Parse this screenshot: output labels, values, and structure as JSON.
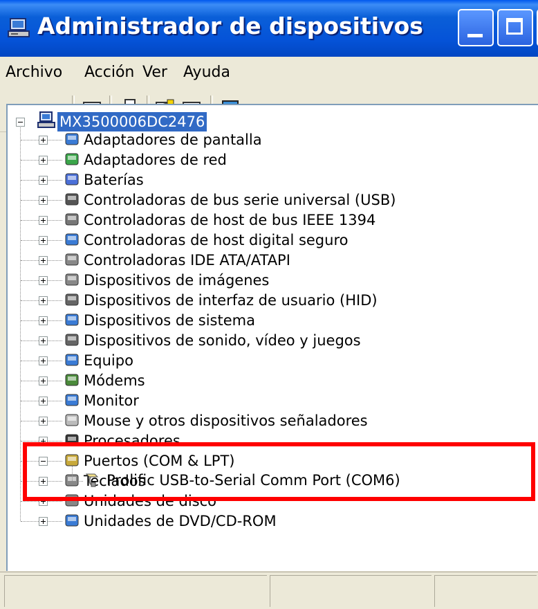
{
  "window": {
    "title": "Administrador de dispositivos"
  },
  "menu": [
    "Archivo",
    "Acción",
    "Ver",
    "Ayuda"
  ],
  "toolbar": {
    "icons": [
      "back-arrow-icon",
      "forward-arrow-icon",
      "show-hide-console-tree-icon",
      "print-icon",
      "help-icon",
      "properties-icon",
      "scan-hardware-icon"
    ]
  },
  "tree": {
    "root": "MX3500006DC2476",
    "categories": [
      {
        "label": "Adaptadores de pantalla",
        "icon": "display-adapter-icon"
      },
      {
        "label": "Adaptadores de red",
        "icon": "network-adapter-icon"
      },
      {
        "label": "Baterías",
        "icon": "battery-icon"
      },
      {
        "label": "Controladoras de bus serie universal (USB)",
        "icon": "usb-icon"
      },
      {
        "label": "Controladoras de host de bus IEEE 1394",
        "icon": "ieee1394-icon"
      },
      {
        "label": "Controladoras de host digital seguro",
        "icon": "sd-host-icon"
      },
      {
        "label": "Controladoras IDE ATA/ATAPI",
        "icon": "ide-controller-icon"
      },
      {
        "label": "Dispositivos de imágenes",
        "icon": "camera-icon"
      },
      {
        "label": "Dispositivos de interfaz de usuario (HID)",
        "icon": "hid-icon"
      },
      {
        "label": "Dispositivos de sistema",
        "icon": "system-device-icon"
      },
      {
        "label": "Dispositivos de sonido, vídeo y juegos",
        "icon": "sound-icon"
      },
      {
        "label": "Equipo",
        "icon": "computer-icon"
      },
      {
        "label": "Módems",
        "icon": "modem-icon"
      },
      {
        "label": "Monitor",
        "icon": "monitor-icon"
      },
      {
        "label": "Mouse y otros dispositivos señaladores",
        "icon": "mouse-icon"
      },
      {
        "label": "Procesadores",
        "icon": "processor-icon"
      },
      {
        "label": "Puertos (COM & LPT)",
        "icon": "port-icon"
      },
      {
        "label": "Teclados",
        "icon": "keyboard-icon"
      },
      {
        "label": "Unidades de disco",
        "icon": "disk-drive-icon"
      },
      {
        "label": "Unidades de DVD/CD-ROM",
        "icon": "dvd-icon"
      }
    ],
    "port_child": "Prolific USB-to-Serial Comm Port (COM6)"
  },
  "colors": {
    "highlight": "#FF0000",
    "selection": "#316AC5",
    "titlebar": "#0553D8"
  }
}
